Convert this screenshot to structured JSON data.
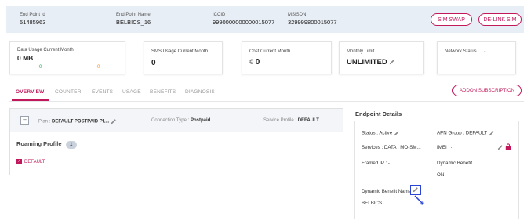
{
  "header": {
    "end_point_id_label": "End Point Id",
    "end_point_id": "51485963",
    "end_point_name_label": "End Point Name",
    "end_point_name": "BELBICS_16",
    "iccid_label": "ICCID",
    "iccid": "9990000000000015077",
    "msisdn_label": "MSISDN",
    "msisdn": "329999800015077",
    "sim_swap_label": "SIM SWAP",
    "delink_sim_label": "DE-LINK SIM"
  },
  "cards": {
    "data_usage_label": "Data Usage Current Month",
    "data_usage_value": "0 MB",
    "data_up": "0",
    "data_down": "0",
    "sms_label": "SMS Usage Current Month",
    "sms_value": "0",
    "cost_label": "Cost Current Month",
    "cost_currency": "€",
    "cost_value": "0",
    "limit_label": "Monthly Limit",
    "limit_value": "UNLIMITED",
    "network_label": "Network Status",
    "network_value": "-"
  },
  "tabs": [
    "OVERVIEW",
    "COUNTER",
    "EVENTS",
    "USAGE",
    "BENEFITS",
    "DIAGNOSIS"
  ],
  "add_subscription_label": "ADDON SUBSCRIPTION",
  "plan": {
    "plan_label": "Plan :",
    "plan_value": "DEFAULT POSTPAID PL...",
    "connection_label": "Connection Type :",
    "connection_value": "Postpaid",
    "service_label": "Service Profile :",
    "service_value": "DEFAULT"
  },
  "roaming": {
    "title": "Roaming Profile",
    "count": "1",
    "item": "DEFAULT"
  },
  "endpoint": {
    "title": "Endpoint Details",
    "status": "Status : Active",
    "apn": "APN Group : DEFAULT",
    "services": "Services : DATA , MO-SM...",
    "imei": "IMEI : -",
    "framed_ip": "Framed IP : -",
    "dynamic_benefit_label": "Dynamic Benefit",
    "dynamic_benefit_value": "ON",
    "dynamic_benefit_name_label": "Dynamic Benefit Name",
    "dynamic_benefit_name_value": "BELBICS"
  },
  "colors": {
    "accent": "#c2185b",
    "header_bg": "#e8eef5",
    "up_green": "#2e9e4f",
    "down_orange": "#f08a24",
    "highlight_blue": "#2b44d6"
  }
}
